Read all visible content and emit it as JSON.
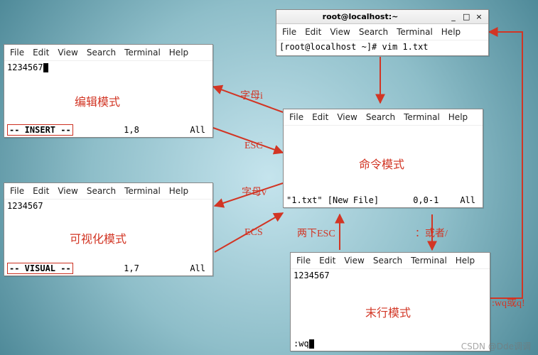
{
  "menus": {
    "file": "File",
    "edit": "Edit",
    "view": "View",
    "search": "Search",
    "terminal": "Terminal",
    "help": "Help"
  },
  "top_window": {
    "title": "root@localhost:~",
    "btn_min": "_",
    "btn_max": "□",
    "btn_close": "×",
    "prompt": "[root@localhost ~]# vim 1.txt"
  },
  "edit_window": {
    "text": "1234567",
    "status_left": "-- INSERT --",
    "status_mid": "1,8",
    "status_right": "All"
  },
  "visual_window": {
    "text": "1234567",
    "status_left": "-- VISUAL --",
    "status_mid": "1,7",
    "status_right": "All"
  },
  "command_window": {
    "status_left": "\"1.txt\" [New File]",
    "status_mid": "0,0-1",
    "status_right": "All"
  },
  "lastline_window": {
    "text": "1234567",
    "status_left": ":wq"
  },
  "labels": {
    "edit_mode": "编辑模式",
    "visual_mode": "可视化模式",
    "command_mode": "命令模式",
    "lastline_mode": "末行模式",
    "letter_i": "字母i",
    "letter_v": "字母v",
    "esc": "ESC",
    "ecs": "ECS",
    "double_esc": "两下ESC",
    "colon_or_slash": "：或者/",
    "wq_or_q": ":wq或q!"
  },
  "watermark": "CSDN @Dde调调"
}
